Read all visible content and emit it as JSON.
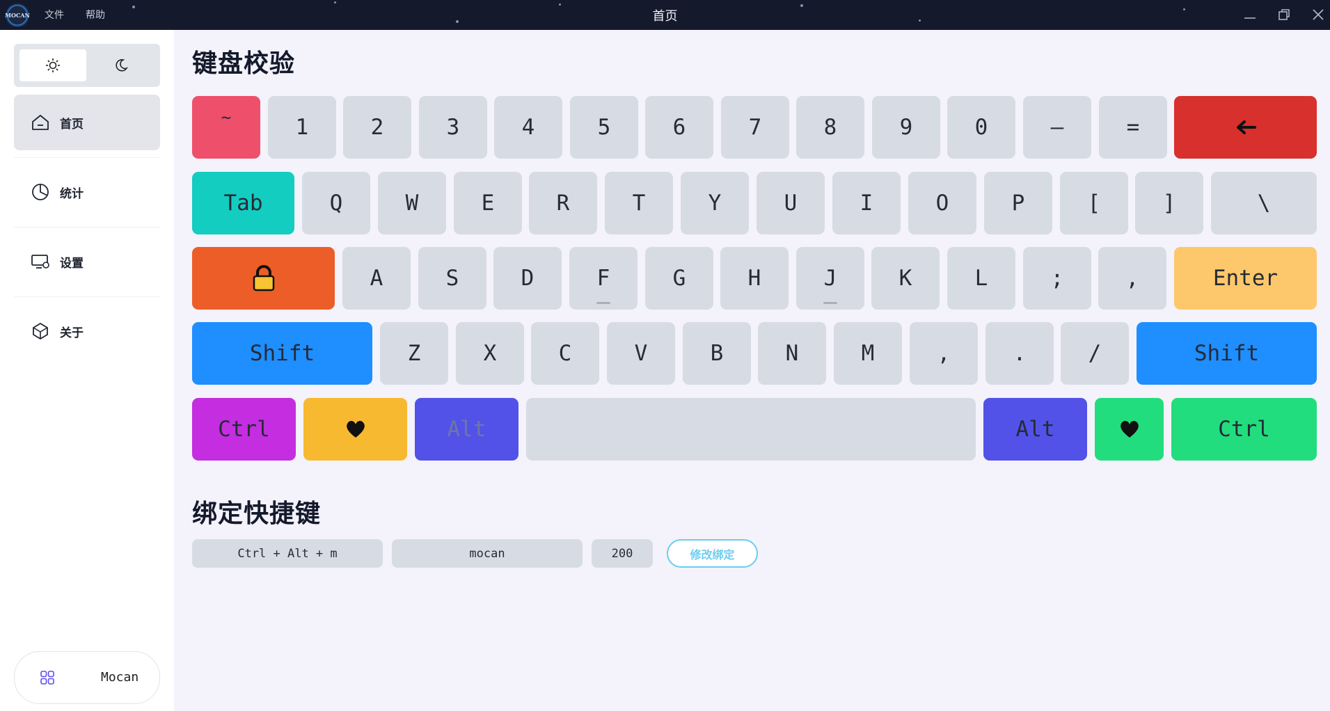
{
  "window": {
    "logo_text": "MOCAN",
    "menu": [
      "文件",
      "帮助"
    ],
    "title": "首页",
    "controls": [
      "minimize-icon",
      "restore-icon",
      "close-icon"
    ]
  },
  "sidebar": {
    "theme_toggle": {
      "options": [
        "sun-icon",
        "moon-icon"
      ],
      "selected": "light"
    },
    "items": [
      {
        "label": "首页",
        "icon": "home-icon",
        "active": true
      },
      {
        "label": "统计",
        "icon": "pie-chart-icon",
        "active": false
      },
      {
        "label": "设置",
        "icon": "monitor-settings-icon",
        "active": false
      },
      {
        "label": "关于",
        "icon": "cube-icon",
        "active": false
      }
    ],
    "user": {
      "name": "Mocan",
      "icon": "grid-icon"
    }
  },
  "keyboard": {
    "title": "键盘校验",
    "rows": [
      [
        {
          "label": "~",
          "color": "#ee4f6b"
        },
        {
          "label": "1"
        },
        {
          "label": "2"
        },
        {
          "label": "3"
        },
        {
          "label": "4"
        },
        {
          "label": "5"
        },
        {
          "label": "6"
        },
        {
          "label": "7"
        },
        {
          "label": "8"
        },
        {
          "label": "9"
        },
        {
          "label": "0"
        },
        {
          "label": "–"
        },
        {
          "label": "="
        },
        {
          "label": "←",
          "color": "#d8302d",
          "icon": "backspace-arrow-icon"
        }
      ],
      [
        {
          "label": "Tab",
          "color": "#13cdc1"
        },
        {
          "label": "Q"
        },
        {
          "label": "W"
        },
        {
          "label": "E"
        },
        {
          "label": "R"
        },
        {
          "label": "T"
        },
        {
          "label": "Y"
        },
        {
          "label": "U"
        },
        {
          "label": "I"
        },
        {
          "label": "O"
        },
        {
          "label": "P"
        },
        {
          "label": "["
        },
        {
          "label": "]"
        },
        {
          "label": "\\"
        }
      ],
      [
        {
          "label": "",
          "color": "#ed5d28",
          "icon": "lock-icon"
        },
        {
          "label": "A"
        },
        {
          "label": "S"
        },
        {
          "label": "D"
        },
        {
          "label": "F"
        },
        {
          "label": "G"
        },
        {
          "label": "H"
        },
        {
          "label": "J"
        },
        {
          "label": "K"
        },
        {
          "label": "L"
        },
        {
          "label": ";"
        },
        {
          "label": ","
        },
        {
          "label": "Enter",
          "color": "#fdc86b"
        }
      ],
      [
        {
          "label": "Shift",
          "color": "#1f8eff"
        },
        {
          "label": "Z"
        },
        {
          "label": "X"
        },
        {
          "label": "C"
        },
        {
          "label": "V"
        },
        {
          "label": "B"
        },
        {
          "label": "N"
        },
        {
          "label": "M"
        },
        {
          "label": ","
        },
        {
          "label": "."
        },
        {
          "label": "/"
        },
        {
          "label": "Shift",
          "color": "#1f8eff"
        }
      ],
      [
        {
          "label": "Ctrl",
          "color": "#c42ee0"
        },
        {
          "label": "",
          "color": "#f7b930",
          "icon": "heart-icon"
        },
        {
          "label": "Alt",
          "color": "#5252e8",
          "text_color": "#7075a8"
        },
        {
          "label": "",
          "icon": "space-bar"
        },
        {
          "label": "Alt",
          "color": "#5252e8"
        },
        {
          "label": "",
          "color": "#22dd7d",
          "icon": "heart-icon"
        },
        {
          "label": "Ctrl",
          "color": "#22dd7d"
        }
      ]
    ],
    "home_row_markers": [
      "F",
      "J"
    ]
  },
  "binding": {
    "title": "绑定快捷键",
    "shortcut": "Ctrl + Alt + m",
    "name": "mocan",
    "delay": "200",
    "button_label": "修改绑定"
  }
}
